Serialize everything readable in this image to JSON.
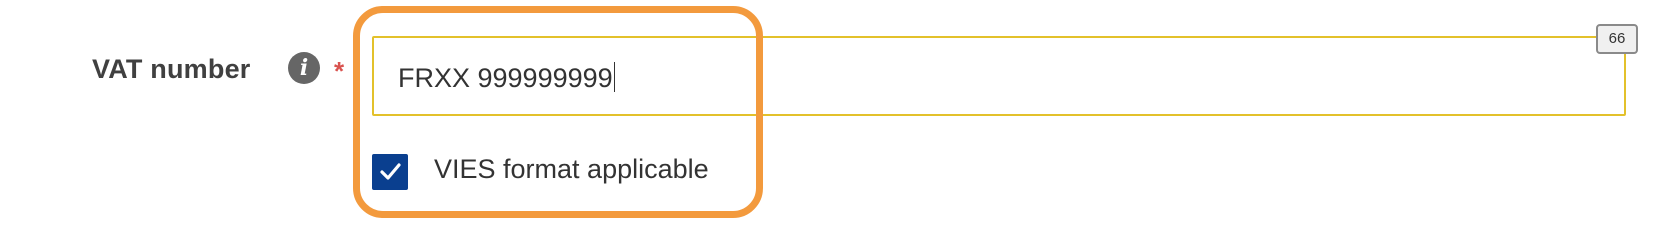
{
  "field": {
    "label": "VAT number",
    "info_icon": "info-circle-icon",
    "required_marker": "*",
    "value": "FRXX 999999999",
    "char_counter": "66"
  },
  "vies": {
    "label": "VIES format applicable",
    "checked": true,
    "check_icon": "checkmark-icon"
  },
  "colors": {
    "input_border": "#e3c12b",
    "checkbox_fill": "#0a3f8f",
    "highlight": "#f39a3d",
    "required": "#d9534f"
  }
}
